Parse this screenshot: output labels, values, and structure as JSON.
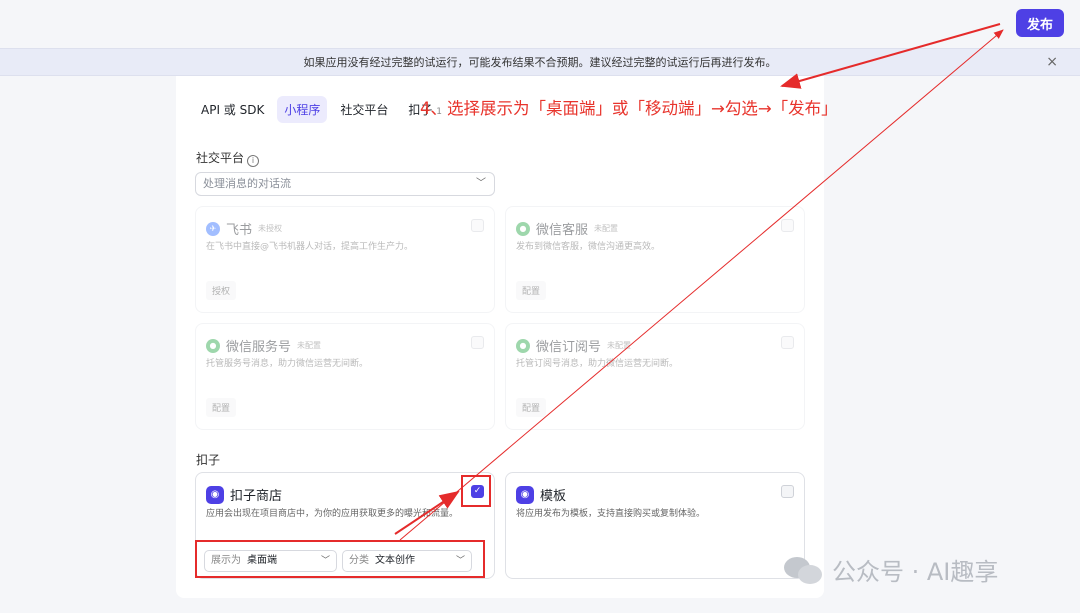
{
  "topbar": {
    "publish_label": "发布"
  },
  "banner": {
    "message": "如果应用没有经过完整的试运行，可能发布结果不合预期。建议经过完整的试运行后再进行发布。",
    "close_icon": "×"
  },
  "tabs": [
    {
      "label": "API 或 SDK",
      "active": false
    },
    {
      "label": "小程序",
      "active": true
    },
    {
      "label": "社交平台",
      "active": false
    },
    {
      "label": "扣子",
      "badge": "1",
      "active": false
    }
  ],
  "annotation": {
    "text": "4、选择展示为「桌面端」或「移动端」→勾选→「发布」",
    "color": "#e8342c"
  },
  "social": {
    "section_label": "社交平台",
    "info_icon": "i",
    "select_placeholder": "处理消息的对话流",
    "cards": [
      {
        "title": "飞书",
        "tag": "未授权",
        "desc": "在飞书中直接@飞书机器人对话，提高工作生产力。",
        "action": "授权",
        "icon": "feishu-icon"
      },
      {
        "title": "微信客服",
        "tag": "未配置",
        "desc": "发布到微信客服，微信沟通更高效。",
        "action": "配置",
        "icon": "wechat-icon"
      },
      {
        "title": "微信服务号",
        "tag": "未配置",
        "desc": "托管服务号消息，助力微信运营无间断。",
        "action": "配置",
        "icon": "wechat-icon"
      },
      {
        "title": "微信订阅号",
        "tag": "未配置",
        "desc": "托管订阅号消息，助力微信运营无间断。",
        "action": "配置",
        "icon": "wechat-icon"
      }
    ]
  },
  "coze": {
    "section_label": "扣子",
    "store_card": {
      "title": "扣子商店",
      "desc": "应用会出现在项目商店中，为你的应用获取更多的曝光和流量。",
      "checked": true,
      "display_label": "展示为",
      "display_value": "桌面端",
      "category_label": "分类",
      "category_value": "文本创作"
    },
    "template_card": {
      "title": "模板",
      "desc": "将应用发布为模板，支持直接购买或复制体验。",
      "checked": false
    }
  },
  "watermark": {
    "text": "公众号 · AI趣享"
  },
  "colors": {
    "accent": "#4e40e5",
    "annotation_red": "#e52b2b"
  }
}
